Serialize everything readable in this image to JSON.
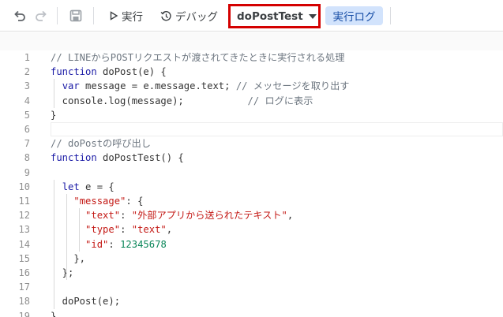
{
  "toolbar": {
    "undo_icon": "undo-icon",
    "redo_icon": "redo-icon",
    "save_icon": "save-icon",
    "run_label": "実行",
    "debug_label": "デバッグ",
    "function_select": "doPostTest",
    "execution_log_label": "実行ログ",
    "highlight_color": "#d40000"
  },
  "editor": {
    "lines": [
      {
        "n": "1",
        "parts": [
          [
            "cm",
            "// LINEからPOSTリクエストが渡されてきたときに実行される処理"
          ]
        ]
      },
      {
        "n": "2",
        "parts": [
          [
            "kw",
            "function"
          ],
          [
            "",
            " doPost(e) {"
          ]
        ]
      },
      {
        "n": "3",
        "parts": [
          [
            "",
            "  "
          ],
          [
            "kw",
            "var"
          ],
          [
            "",
            " message = e.message.text; "
          ],
          [
            "cm",
            "// メッセージを取り出す"
          ]
        ]
      },
      {
        "n": "4",
        "parts": [
          [
            "",
            "  console.log(message);           "
          ],
          [
            "cm",
            "// ログに表示"
          ]
        ]
      },
      {
        "n": "5",
        "parts": [
          [
            "",
            "}"
          ]
        ]
      },
      {
        "n": "6",
        "parts": [
          [
            "",
            ""
          ]
        ]
      },
      {
        "n": "7",
        "parts": [
          [
            "cm",
            "// doPostの呼び出し"
          ]
        ]
      },
      {
        "n": "8",
        "parts": [
          [
            "kw",
            "function"
          ],
          [
            "",
            " doPostTest() {"
          ]
        ]
      },
      {
        "n": "9",
        "parts": [
          [
            "",
            ""
          ]
        ]
      },
      {
        "n": "10",
        "parts": [
          [
            "",
            "  "
          ],
          [
            "kw",
            "let"
          ],
          [
            "",
            " e = {"
          ]
        ]
      },
      {
        "n": "11",
        "parts": [
          [
            "",
            "    "
          ],
          [
            "str",
            "\"message\""
          ],
          [
            "",
            ": {"
          ]
        ]
      },
      {
        "n": "12",
        "parts": [
          [
            "",
            "      "
          ],
          [
            "str",
            "\"text\""
          ],
          [
            "",
            ": "
          ],
          [
            "str",
            "\"外部アプリから送られたテキスト\""
          ],
          [
            "",
            ","
          ]
        ]
      },
      {
        "n": "13",
        "parts": [
          [
            "",
            "      "
          ],
          [
            "str",
            "\"type\""
          ],
          [
            "",
            ": "
          ],
          [
            "str",
            "\"text\""
          ],
          [
            "",
            ","
          ]
        ]
      },
      {
        "n": "14",
        "parts": [
          [
            "",
            "      "
          ],
          [
            "str",
            "\"id\""
          ],
          [
            "",
            ": "
          ],
          [
            "num",
            "12345678"
          ]
        ]
      },
      {
        "n": "15",
        "parts": [
          [
            "",
            "    },"
          ]
        ]
      },
      {
        "n": "16",
        "parts": [
          [
            "",
            "  };"
          ]
        ]
      },
      {
        "n": "17",
        "parts": [
          [
            "",
            ""
          ]
        ]
      },
      {
        "n": "18",
        "parts": [
          [
            "",
            "  doPost(e);"
          ]
        ]
      },
      {
        "n": "19",
        "parts": [
          [
            "",
            "}"
          ]
        ]
      }
    ],
    "current_line": "6"
  }
}
